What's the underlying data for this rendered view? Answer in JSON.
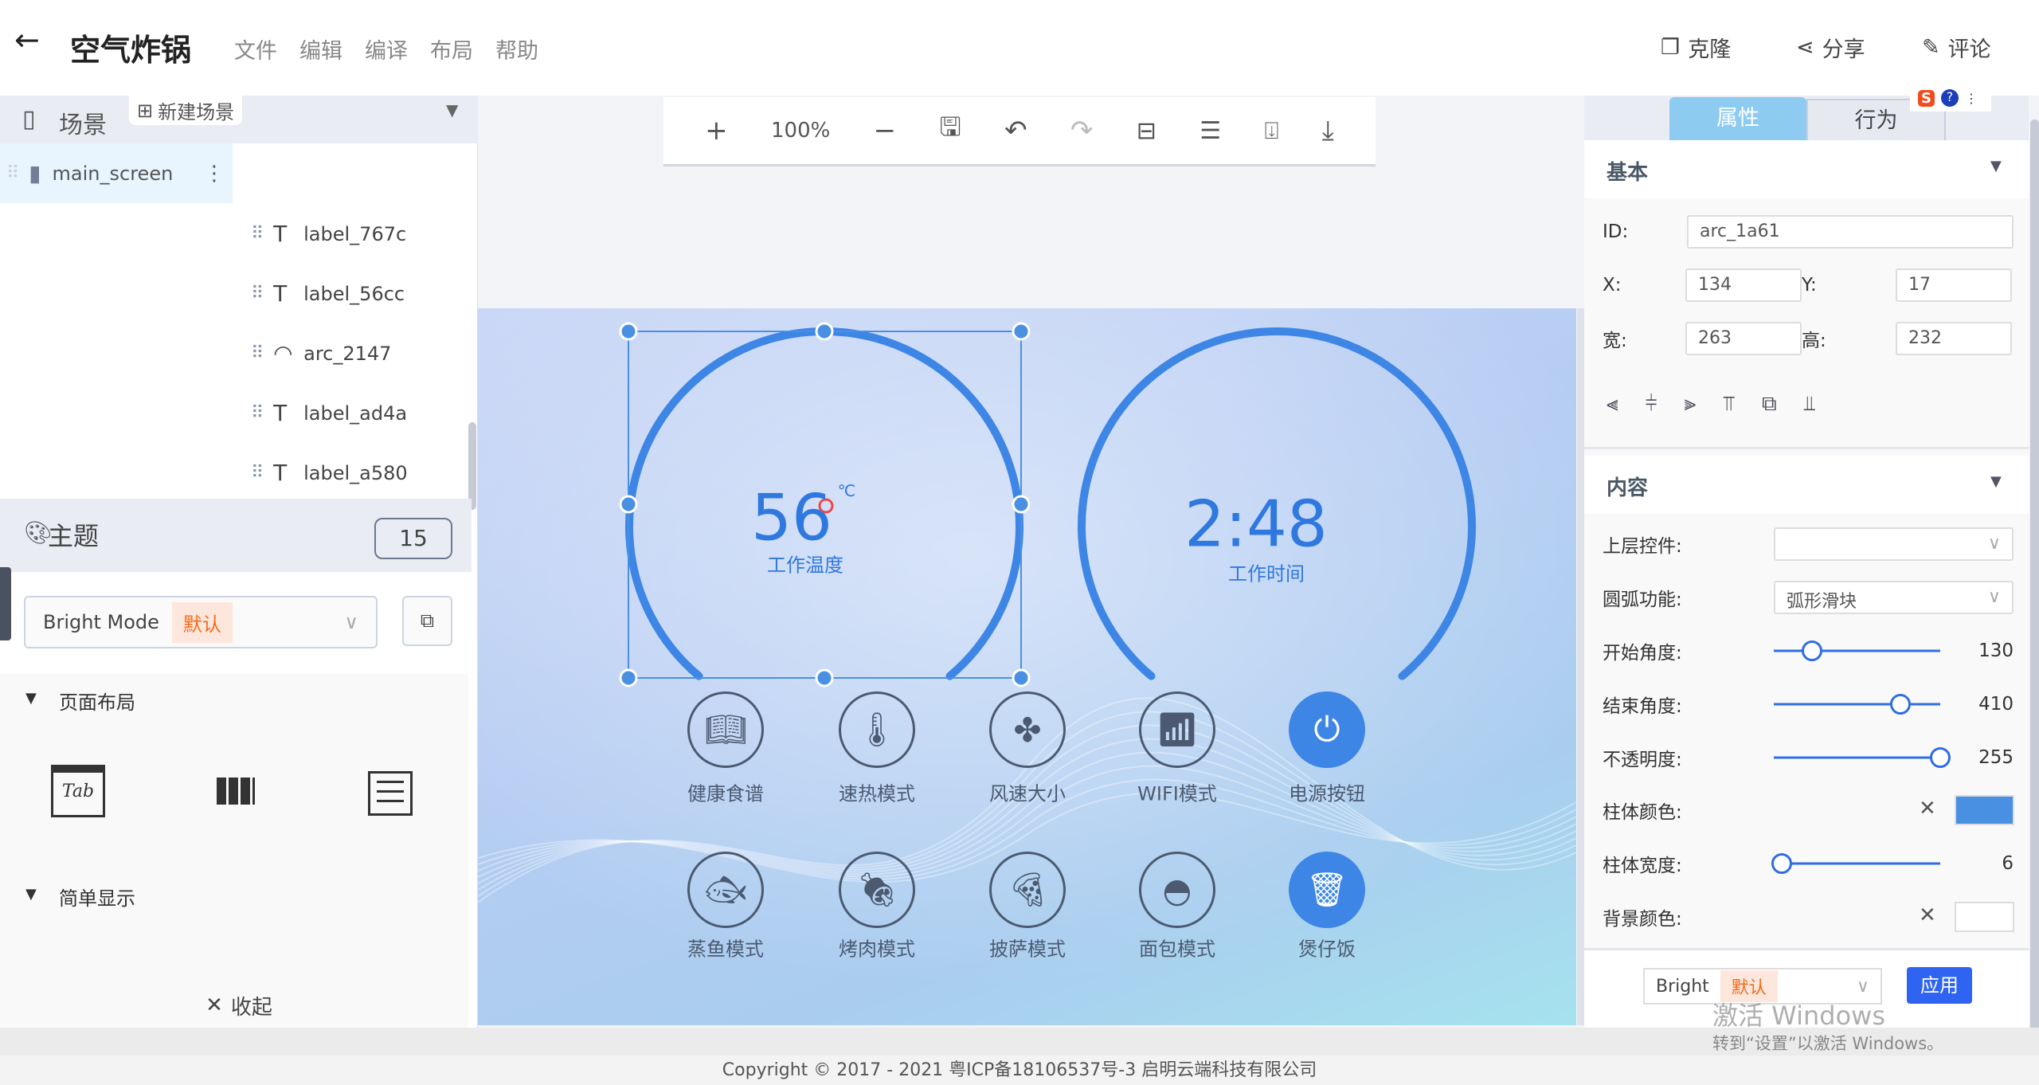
{
  "header": {
    "title": "空气炸锅",
    "menu": [
      "文件",
      "编辑",
      "编译",
      "布局",
      "帮助"
    ],
    "actions": {
      "clone": "克隆",
      "share": "分享",
      "comment": "评论"
    }
  },
  "scene": {
    "title": "场景",
    "new_scene": "新建场景",
    "screen": "main_screen",
    "widgets": [
      {
        "name": "label_767c",
        "type": "label"
      },
      {
        "name": "label_56cc",
        "type": "label"
      },
      {
        "name": "arc_2147",
        "type": "arc"
      },
      {
        "name": "label_ad4a",
        "type": "label"
      },
      {
        "name": "label_a580",
        "type": "label"
      },
      {
        "name": "arc_1a61",
        "type": "arc",
        "selected": true
      }
    ]
  },
  "theme": {
    "title": "主题",
    "count": "15",
    "mode": "Bright Mode",
    "default_tag": "默认"
  },
  "layout": {
    "page_layout": "页面布局",
    "simple_display": "简单显示",
    "collapse": "收起",
    "icons": [
      "tab-icon",
      "columns-icon",
      "list-icon"
    ],
    "tab_text": "Tab"
  },
  "toolbar": {
    "zoom": "100%"
  },
  "canvas": {
    "temp_value": "56",
    "temp_unit": "℃",
    "temp_label": "工作温度",
    "time_value": "2:48",
    "time_label": "工作时间",
    "buttons_row1": [
      {
        "label": "健康食谱",
        "icon": "recipe-icon"
      },
      {
        "label": "速热模式",
        "icon": "thermometer-icon"
      },
      {
        "label": "风速大小",
        "icon": "fan-icon"
      },
      {
        "label": "WIFI模式",
        "icon": "wifi-icon"
      },
      {
        "label": "电源按钮",
        "icon": "power-icon",
        "active": true
      }
    ],
    "buttons_row2": [
      {
        "label": "蒸鱼模式",
        "icon": "fish-icon"
      },
      {
        "label": "烤肉模式",
        "icon": "drumstick-icon"
      },
      {
        "label": "披萨模式",
        "icon": "pizza-icon"
      },
      {
        "label": "面包模式",
        "icon": "bread-icon"
      },
      {
        "label": "煲仔饭",
        "icon": "pot-icon",
        "active": true
      }
    ],
    "accent": "#3d86e6"
  },
  "props": {
    "tabs": [
      "属性",
      "行为"
    ],
    "basic": "基本",
    "content": "内容",
    "id_label": "ID:",
    "id": "arc_1a61",
    "x_label": "X:",
    "x": "134",
    "y_label": "Y:",
    "y": "17",
    "w_label": "宽:",
    "w": "263",
    "h_label": "高:",
    "h": "232",
    "parent_label": "上层控件:",
    "parent": "",
    "arc_func_label": "圆弧功能:",
    "arc_func": "弧形滑块",
    "sliders": [
      {
        "label": "开始角度:",
        "value": "130",
        "fill": 0.23
      },
      {
        "label": "结束角度:",
        "value": "410",
        "fill": 0.76
      },
      {
        "label": "不透明度:",
        "value": "255",
        "fill": 1.0
      },
      {
        "label": "柱体宽度:",
        "value": "6",
        "fill": 0.05
      }
    ],
    "bar_color_label": "柱体颜色:",
    "bar_color": "#4a90e2",
    "bg_color_label": "背景颜色:",
    "bg_color": "#ffffff",
    "theme_select": "Bright",
    "theme_tag": "默认",
    "apply": "应用"
  },
  "watermark": {
    "line1": "激活 Windows",
    "line2": "转到“设置”以激活 Windows。"
  },
  "footer": {
    "copyright": "Copyright © 2017 - 2021 粤ICP备18106537号-3 启明云端科技有限公司"
  }
}
